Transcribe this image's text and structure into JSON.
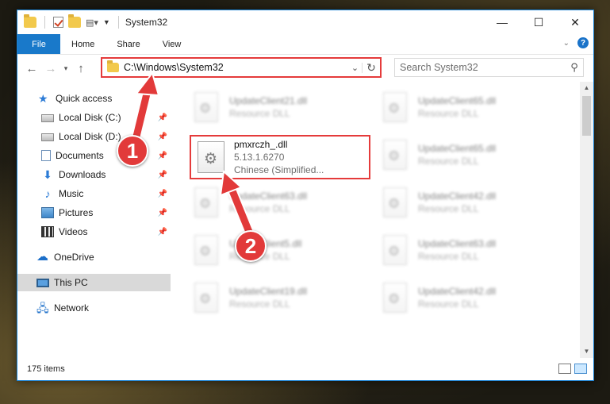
{
  "window": {
    "title": "System32",
    "controls": {
      "minimize": "—",
      "maximize": "☐",
      "close": "✕"
    }
  },
  "ribbon": {
    "tabs": [
      "File",
      "Home",
      "Share",
      "View"
    ],
    "expand_icon": "chevron-down-icon",
    "help": "?"
  },
  "nav": {
    "address": "C:\\Windows\\System32",
    "search_placeholder": "Search System32"
  },
  "sidebar": {
    "items": [
      {
        "label": "Quick access",
        "icon": "star-icon",
        "pinned": false
      },
      {
        "label": "Local Disk (C:)",
        "icon": "disk-icon",
        "pinned": true
      },
      {
        "label": "Local Disk (D:)",
        "icon": "disk-icon",
        "pinned": true
      },
      {
        "label": "Documents",
        "icon": "documents-icon",
        "pinned": true
      },
      {
        "label": "Downloads",
        "icon": "download-icon",
        "pinned": true
      },
      {
        "label": "Music",
        "icon": "music-icon",
        "pinned": true
      },
      {
        "label": "Pictures",
        "icon": "pictures-icon",
        "pinned": true
      },
      {
        "label": "Videos",
        "icon": "videos-icon",
        "pinned": true
      },
      {
        "label": "OneDrive",
        "icon": "onedrive-icon",
        "pinned": false
      },
      {
        "label": "This PC",
        "icon": "this-pc-icon",
        "pinned": false
      },
      {
        "label": "Network",
        "icon": "network-icon",
        "pinned": false
      }
    ]
  },
  "files": {
    "background": [
      {
        "name": "UpdateClient21.dll",
        "type": "Resource DLL"
      },
      {
        "name": "UpdateClient65.dll",
        "type": "Resource DLL"
      },
      {
        "name": "UpdateClient65.dll",
        "type": "Resource DLL"
      },
      {
        "name": "UpdateClient63.dll",
        "type": "Resource DLL"
      },
      {
        "name": "UpdateClient42.dll",
        "type": "Resource DLL"
      },
      {
        "name": "UpdateClient5.dll",
        "type": "Resource DLL"
      },
      {
        "name": "UpdateClient63.dll",
        "type": "Resource DLL"
      },
      {
        "name": "UpdateClient19.dll",
        "type": "Resource DLL"
      },
      {
        "name": "UpdateClient42.dll",
        "type": "Resource DLL"
      }
    ],
    "highlighted": {
      "name": "pmxrczh_.dll",
      "version": "5.13.1.6270",
      "description": "Chinese (Simplified..."
    }
  },
  "status": {
    "item_count": "175 items"
  },
  "annotations": {
    "step1": "1",
    "step2": "2"
  },
  "colors": {
    "accent": "#1979ca",
    "annotation": "#e23a3a"
  }
}
